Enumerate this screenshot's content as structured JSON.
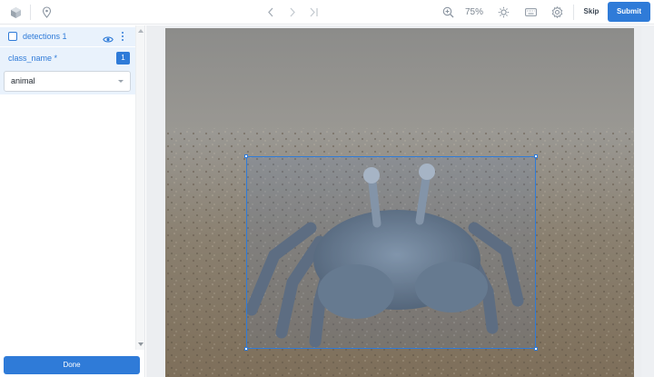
{
  "toolbar": {
    "zoom_label": "75%",
    "skip_label": "Skip",
    "submit_label": "Submit",
    "icons": [
      "app-logo-icon",
      "location-pin-icon",
      "chevron-left-icon",
      "chevron-right-icon",
      "skip-to-end-icon",
      "zoom-in-icon",
      "brightness-icon",
      "keyboard-icon",
      "settings-icon"
    ]
  },
  "panel": {
    "detection_label": "detections 1",
    "attribute_label": "class_name *",
    "attribute_badge": "1",
    "select_value": "animal",
    "done_label": "Done"
  },
  "annotation": {
    "box_color": "#2f7bd8"
  },
  "colors": {
    "accent": "#2f7bd8",
    "panel_highlight": "#e9f2fc"
  }
}
